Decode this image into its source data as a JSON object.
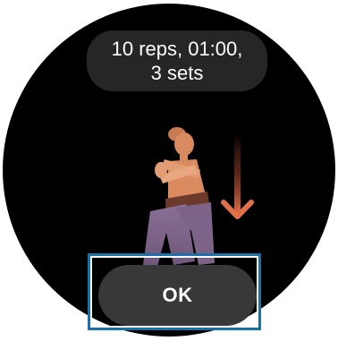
{
  "workout": {
    "summary_line1": "10 reps, 01:00,",
    "summary_line2": "3 sets",
    "illustration_name": "squat-exercise-figure",
    "arrow_icon": "arrow-down-icon",
    "colors": {
      "skin": "#d98a5e",
      "hair": "#c97a52",
      "shorts": "#6b3a2a",
      "legs": "#8b6f95",
      "arrow": "#e0704a"
    }
  },
  "actions": {
    "ok_label": "OK"
  },
  "colors": {
    "background": "#000000",
    "pill": "#262626",
    "button": "#383838",
    "focus": "#1b70a8"
  }
}
